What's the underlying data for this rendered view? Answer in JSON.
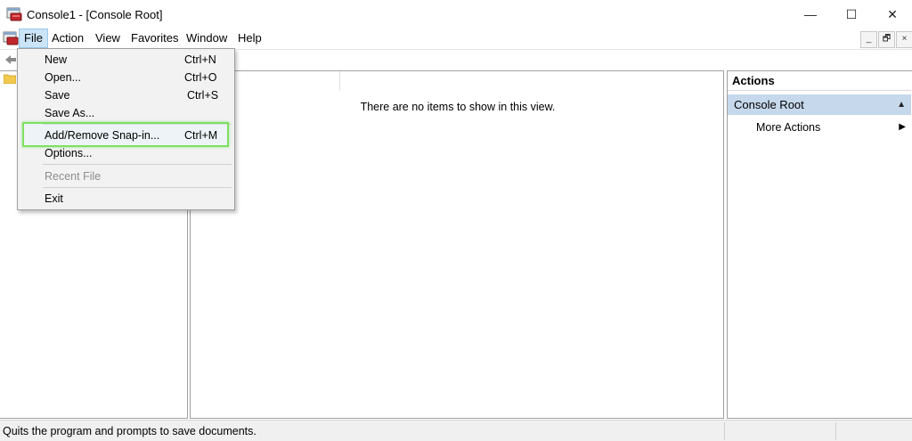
{
  "window": {
    "title": "Console1 - [Console Root]",
    "minimize_glyph": "—",
    "maximize_glyph": "☐",
    "close_glyph": "✕"
  },
  "menubar": {
    "items": [
      "File",
      "Action",
      "View",
      "Favorites",
      "Window",
      "Help"
    ],
    "active": "File",
    "mdi_buttons": [
      "_",
      "🗗",
      "×"
    ]
  },
  "file_menu": {
    "items": [
      {
        "label": "New",
        "accel": "Ctrl+N",
        "enabled": true
      },
      {
        "label": "Open...",
        "accel": "Ctrl+O",
        "enabled": true
      },
      {
        "label": "Save",
        "accel": "Ctrl+S",
        "enabled": true
      },
      {
        "label": "Save As...",
        "accel": "",
        "enabled": true
      },
      {
        "label": "Add/Remove Snap-in...",
        "accel": "Ctrl+M",
        "enabled": true,
        "highlighted": true
      },
      {
        "label": "Options...",
        "accel": "",
        "enabled": true
      },
      {
        "label": "Recent File",
        "accel": "",
        "enabled": false
      },
      {
        "label": "Exit",
        "accel": "",
        "enabled": true
      }
    ]
  },
  "center_pane": {
    "empty_message": "There are no items to show in this view."
  },
  "actions_pane": {
    "header": "Actions",
    "section": "Console Root",
    "items": [
      "More Actions"
    ]
  },
  "statusbar": {
    "text": "Quits the program and prompts to save documents."
  },
  "colors": {
    "highlight_box": "#7ee064",
    "menu_active_bg": "#cce4f7",
    "actions_section_bg": "#c6d8ec"
  }
}
